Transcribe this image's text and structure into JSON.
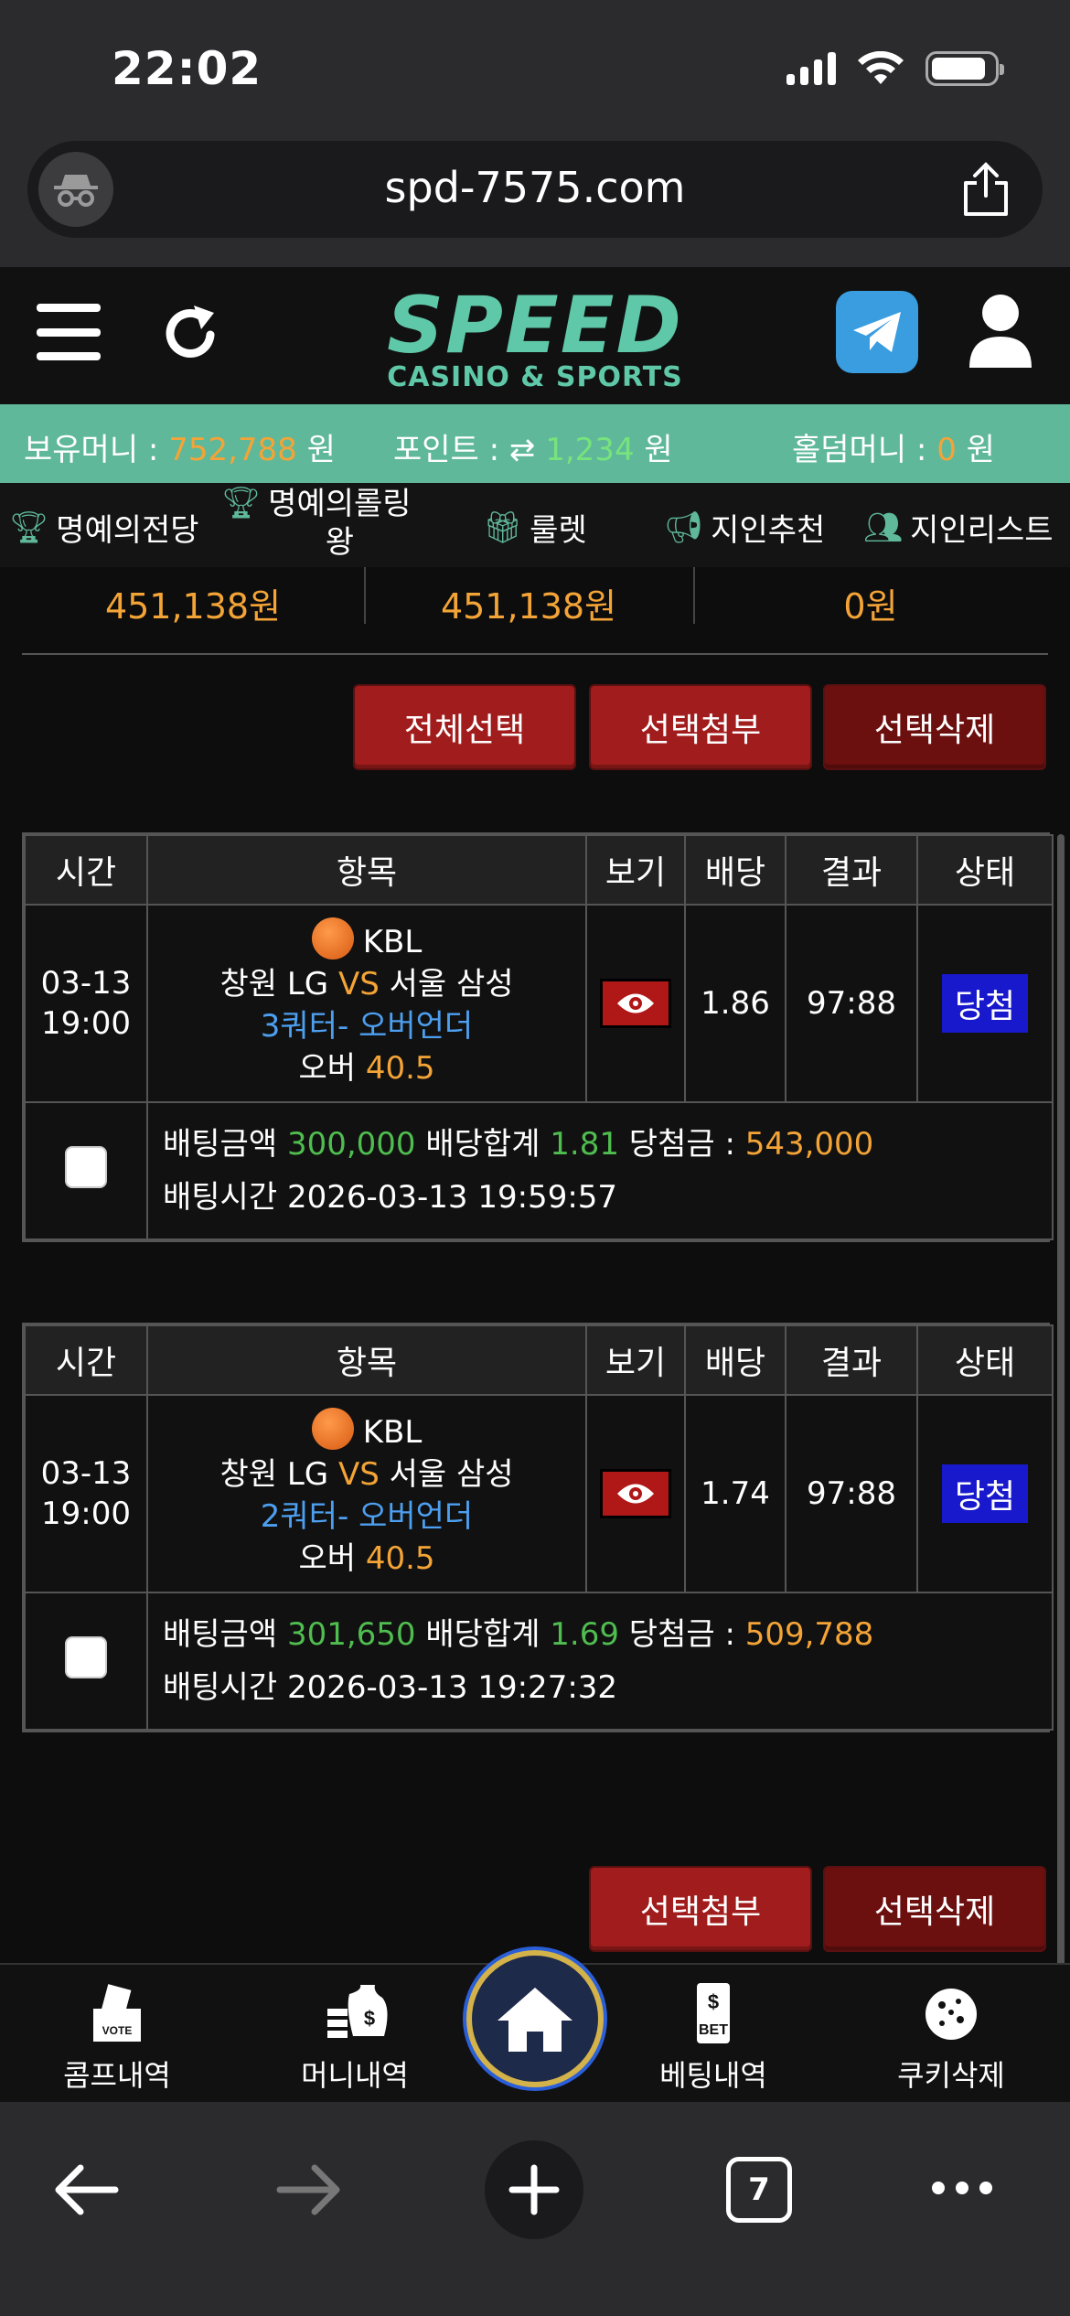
{
  "status_bar": {
    "time": "22:02"
  },
  "browser": {
    "url": "spd-7575.com",
    "tab_count": "7"
  },
  "logo": {
    "main": "SPEED",
    "sub": "CASINO & SPORTS"
  },
  "money_bar": {
    "balance_label": "보유머니 : ",
    "balance_value": "752,788",
    "balance_unit": " 원",
    "point_label": "포인트 : ",
    "point_value": "1,234",
    "point_unit": " 원",
    "holdem_label": "홀덤머니 : ",
    "holdem_value": "0",
    "holdem_unit": " 원"
  },
  "nav": [
    {
      "label": "명예의전당",
      "icon": "trophy-icon"
    },
    {
      "label": "명예의롤링",
      "label2": "왕",
      "icon": "trophy-icon"
    },
    {
      "label": "룰렛",
      "icon": "gift-icon"
    },
    {
      "label": "지인추천",
      "icon": "megaphone-icon"
    },
    {
      "label": "지인리스트",
      "icon": "users-icon"
    }
  ],
  "summary": [
    "451,138원",
    "451,138원",
    "0원"
  ],
  "buttons": {
    "select_all": "전체선택",
    "attach_selected": "선택첨부",
    "delete_selected": "선택삭제"
  },
  "table_headers": {
    "time": "시간",
    "item": "항목",
    "view": "보기",
    "odds": "배당",
    "result": "결과",
    "status": "상태"
  },
  "bets": [
    {
      "date": "03-13",
      "time": "19:00",
      "league": "KBL",
      "home": "창원 LG ",
      "vs": "VS",
      "away": " 서울 삼성",
      "market": "3쿼터- 오버언더",
      "pick_label": "오버 ",
      "pick_value": "40.5",
      "odds": "1.86",
      "result": "97:88",
      "status": "당첨",
      "amount_label": "배팅금액 ",
      "amount": "300,000",
      "total_odds_label": " 배당합계 ",
      "total_odds": "1.81",
      "win_label": " 당첨금 : ",
      "win": "543,000",
      "bet_time_label": "배팅시간 ",
      "bet_time": "2026-03-13 19:59:57"
    },
    {
      "date": "03-13",
      "time": "19:00",
      "league": "KBL",
      "home": "창원 LG ",
      "vs": "VS",
      "away": " 서울 삼성",
      "market": "2쿼터- 오버언더",
      "pick_label": "오버 ",
      "pick_value": "40.5",
      "odds": "1.74",
      "result": "97:88",
      "status": "당첨",
      "amount_label": "배팅금액 ",
      "amount": "301,650",
      "total_odds_label": " 배당합계 ",
      "total_odds": "1.69",
      "win_label": " 당첨금 : ",
      "win": "509,788",
      "bet_time_label": "배팅시간 ",
      "bet_time": "2026-03-13 19:27:32"
    }
  ],
  "tabbar": [
    {
      "label": "콤프내역",
      "icon": "vote-box-icon"
    },
    {
      "label": "머니내역",
      "icon": "money-bag-icon"
    },
    {
      "label": "",
      "icon": "home-icon"
    },
    {
      "label": "베팅내역",
      "icon": "bet-slip-icon"
    },
    {
      "label": "쿠키삭제",
      "icon": "cookie-icon"
    }
  ],
  "colors": {
    "brand": "#5fb89a",
    "orange": "#f4a437",
    "green": "#4fbd4f",
    "blue": "#4d9ff0",
    "button_red": "#a11c1c",
    "status_blue": "#1818cc"
  }
}
